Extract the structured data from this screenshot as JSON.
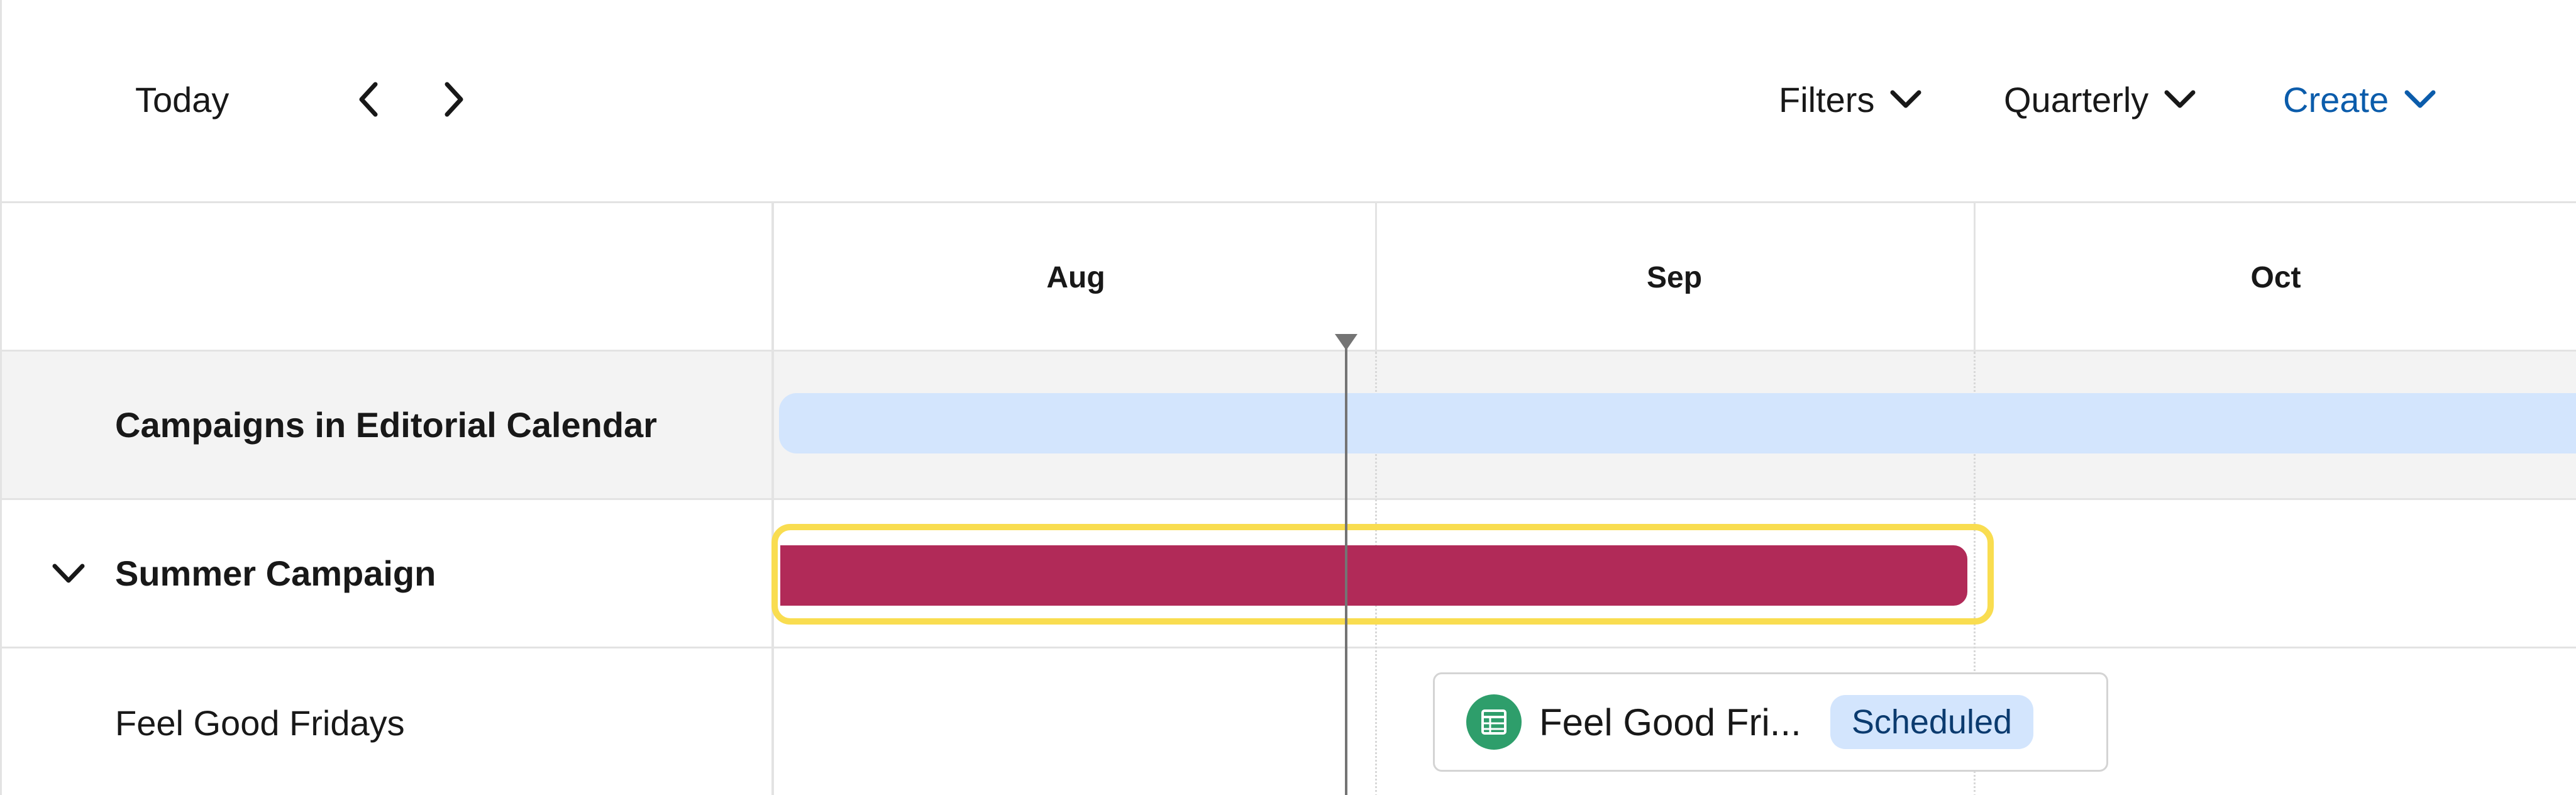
{
  "toolbar": {
    "today_label": "Today",
    "filters_label": "Filters",
    "view_label": "Quarterly",
    "create_label": "Create"
  },
  "timeline": {
    "months": [
      "Aug",
      "Sep",
      "Oct"
    ]
  },
  "rows": [
    {
      "label": "Campaigns in Editorial Calendar"
    },
    {
      "label": "Summer Campaign"
    },
    {
      "label": "Feel Good Fridays"
    }
  ],
  "item": {
    "title": "Feel Good Fri...",
    "status": "Scheduled"
  },
  "colors": {
    "accent": "#0b5cab",
    "campaign_bar": "#d3e5fd",
    "summer_bar": "#b12a58",
    "highlight": "#f9dd50",
    "item_icon": "#2e9e6b"
  },
  "icons": {
    "prev": "chevron-left-icon",
    "next": "chevron-right-icon",
    "dropdown": "chevron-down-icon",
    "item_type": "table-icon"
  }
}
